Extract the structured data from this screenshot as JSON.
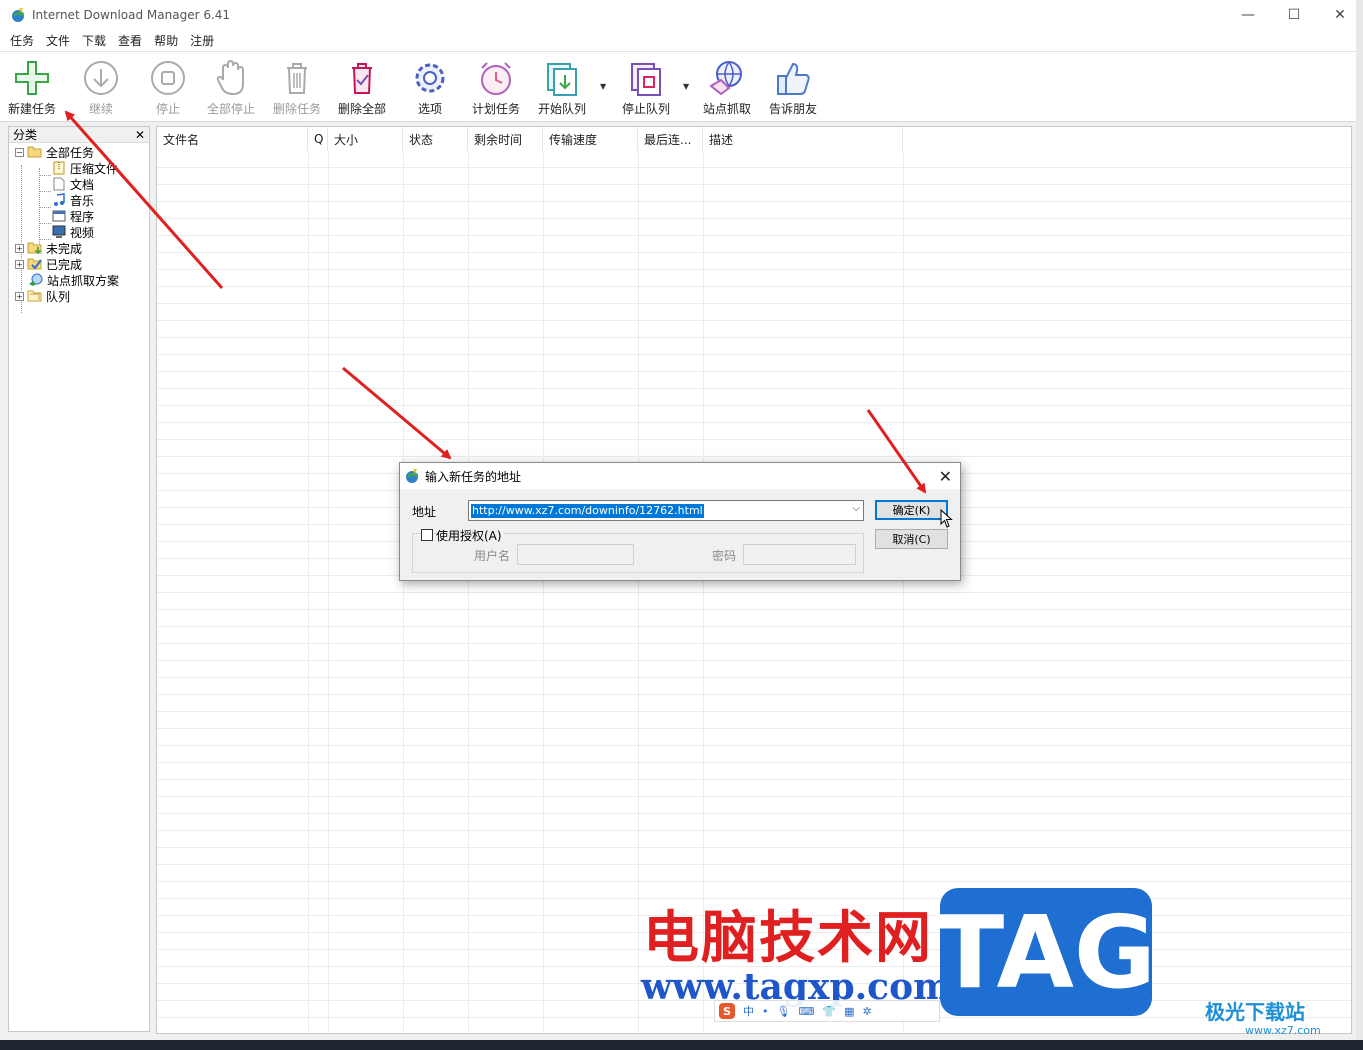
{
  "window": {
    "title": "Internet Download Manager 6.41",
    "minimize": "—",
    "maximize": "☐",
    "close": "✕"
  },
  "menu": [
    "任务",
    "文件",
    "下载",
    "查看",
    "帮助",
    "注册"
  ],
  "toolbar": {
    "new_task": "新建任务",
    "resume": "继续",
    "stop": "停止",
    "stop_all": "全部停止",
    "delete_task": "删除任务",
    "delete_all": "删除全部",
    "options": "选项",
    "scheduler": "计划任务",
    "start_queue": "开始队列",
    "stop_queue": "停止队列",
    "site_grabber": "站点抓取",
    "tell_friend": "告诉朋友"
  },
  "categories": {
    "header": "分类",
    "close": "✕",
    "all": "全部任务",
    "compressed": "压缩文件",
    "documents": "文档",
    "music": "音乐",
    "programs": "程序",
    "video": "视频",
    "unfinished": "未完成",
    "finished": "已完成",
    "grabber_projects": "站点抓取方案",
    "queues": "队列"
  },
  "columns": [
    "文件名",
    "Q",
    "大小",
    "状态",
    "剩余时间",
    "传输速度",
    "最后连...",
    "描述"
  ],
  "dialog": {
    "title": "输入新任务的地址",
    "close": "✕",
    "address_label": "地址",
    "url": "http://www.xz7.com/downinfo/12762.html",
    "ok": "确定(K)",
    "cancel": "取消(C)",
    "use_auth": "使用授权(A)",
    "username_label": "用户名",
    "password_label": "密码"
  },
  "watermark": {
    "cn": "电脑技术网",
    "url": "www.tagxp.com",
    "tag": "TAG",
    "jg": "极光下载站",
    "jg_url": "www.xz7.com"
  },
  "ime": {
    "logo": "S",
    "mode": "中"
  },
  "colors": {
    "accent": "#0078d7",
    "arrow": "#e02020",
    "watermark_red": "#e02020",
    "watermark_blue": "#1f56c9",
    "tag_bg": "#1e6fd1"
  }
}
